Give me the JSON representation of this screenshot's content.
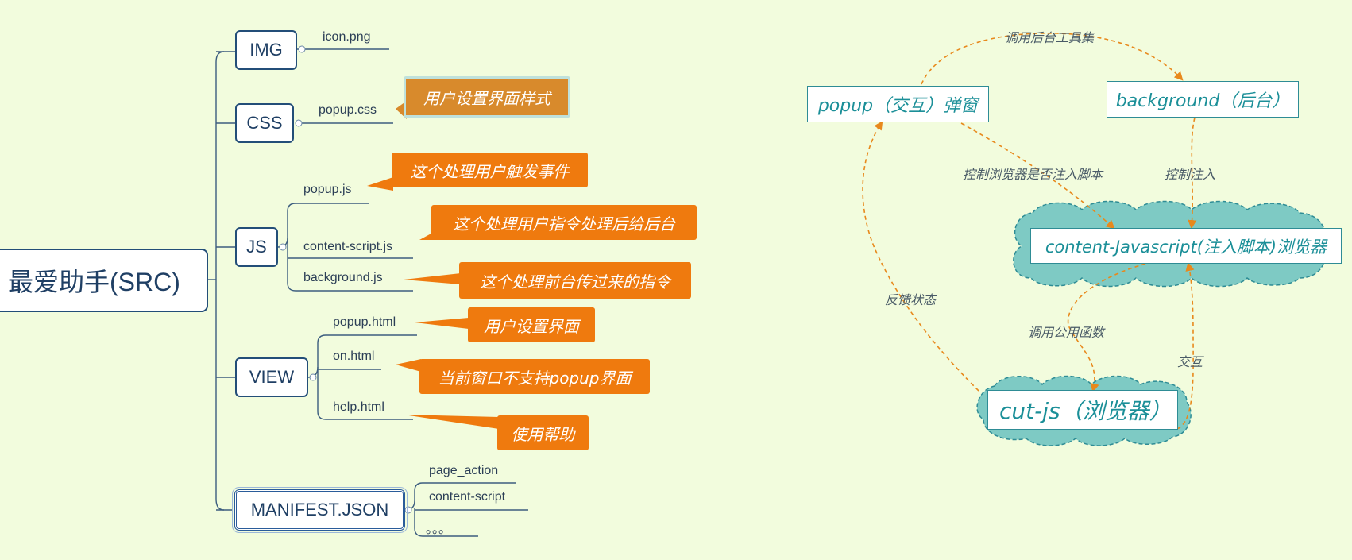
{
  "mindmap": {
    "root": "最爱助手(SRC)",
    "categories": {
      "img": {
        "label": "IMG",
        "files": [
          "icon.png"
        ]
      },
      "css": {
        "label": "CSS",
        "files": [
          "popup.css"
        ],
        "notes": [
          "用户设置界面样式"
        ]
      },
      "js": {
        "label": "JS",
        "files": [
          "popup.js",
          "content-script.js",
          "background.js"
        ],
        "notes": [
          "这个处理用户触发事件",
          "这个处理用户指令处理后给后台",
          "这个处理前台传过来的指令"
        ]
      },
      "view": {
        "label": "VIEW",
        "files": [
          "popup.html",
          "on.html",
          "help.html"
        ],
        "notes": [
          "用户设置界面",
          "当前窗口不支持popup界面",
          "使用帮助"
        ]
      },
      "manifest": {
        "label": "MANIFEST.JSON",
        "files": [
          "page_action",
          "content-script",
          "。。。"
        ]
      }
    }
  },
  "flow": {
    "nodes": {
      "popup": "popup（交互）弹窗",
      "background": "background（后台）",
      "content": "content-Javascript(注入脚本)浏览器",
      "cutjs": "cut-js（浏览器）"
    },
    "edges": {
      "popup_to_background": "调用后台工具集",
      "popup_to_content": "控制浏览器是否注入脚本",
      "background_to_content": "控制注入",
      "cutjs_to_popup": "反馈状态",
      "content_to_cutjs": "调用公用函数",
      "cutjs_to_content": "交互"
    }
  },
  "colors": {
    "background": "#F2FCDD",
    "node_border": "#234E78",
    "callout": "#EF7A0E",
    "teal": "#1B8F98",
    "cloud_fill": "#7ECAC4",
    "arrow": "#E8891C"
  }
}
